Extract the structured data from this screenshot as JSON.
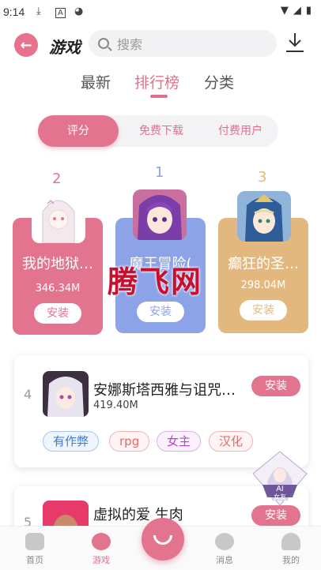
{
  "status": {
    "time": "9:14"
  },
  "header": {
    "brand": "游戏",
    "search_placeholder": "搜索"
  },
  "tabs": [
    {
      "label": "最新"
    },
    {
      "label": "排行榜"
    },
    {
      "label": "分类"
    }
  ],
  "segments": [
    {
      "label": "评分"
    },
    {
      "label": "免费下载"
    },
    {
      "label": "付费用户"
    }
  ],
  "podium": [
    {
      "rank": "2",
      "title": "我的地狱…",
      "size": "346.34M",
      "install": "安装",
      "color": "#e27490"
    },
    {
      "rank": "1",
      "title": "魔王冒险(",
      "size": "",
      "install": "安装",
      "color": "#8da3e8"
    },
    {
      "rank": "3",
      "title": "癫狂的圣…",
      "size": "298.04M",
      "install": "安装",
      "color": "#e3b87f"
    }
  ],
  "watermark": "腾飞网",
  "list": [
    {
      "rank": "4",
      "name": "安娜斯塔西雅与诅咒…",
      "size": "419.40M",
      "install": "安装",
      "tags": [
        "有作弊",
        "rpg",
        "女主",
        "汉化"
      ]
    },
    {
      "rank": "5",
      "name": "虚拟的爱 生肉",
      "size": "",
      "install": "安装",
      "tags": []
    }
  ],
  "ai_badge": {
    "label": "AI",
    "sub": "女友"
  },
  "nav": [
    {
      "label": "首页"
    },
    {
      "label": "游戏"
    },
    {
      "label": "消息"
    },
    {
      "label": "我的"
    }
  ],
  "colors": {
    "accent": "#e27490",
    "blue": "#8da3e8",
    "gold": "#e3b87f"
  }
}
